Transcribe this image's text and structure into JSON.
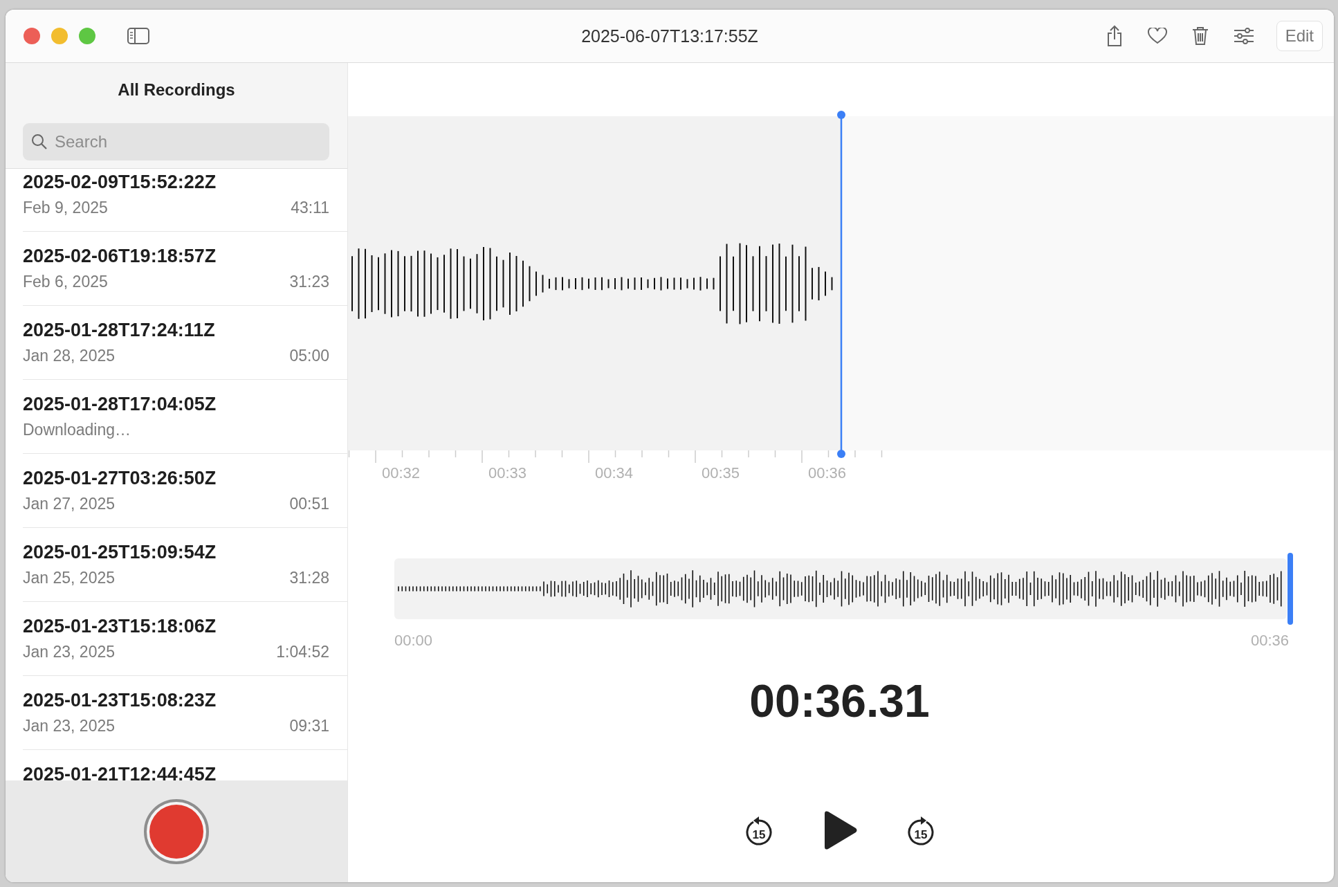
{
  "window": {
    "title": "2025-06-07T13:17:55Z"
  },
  "toolbar": {
    "edit_label": "Edit"
  },
  "sidebar": {
    "title": "All Recordings",
    "search": {
      "placeholder": "Search"
    },
    "recordings": [
      {
        "title": "2025-02-09T15:52:22Z",
        "date": "Feb 9, 2025",
        "duration": "43:11"
      },
      {
        "title": "2025-02-06T19:18:57Z",
        "date": "Feb 6, 2025",
        "duration": "31:23"
      },
      {
        "title": "2025-01-28T17:24:11Z",
        "date": "Jan 28, 2025",
        "duration": "05:00"
      },
      {
        "title": "2025-01-28T17:04:05Z",
        "status": "Downloading…"
      },
      {
        "title": "2025-01-27T03:26:50Z",
        "date": "Jan 27, 2025",
        "duration": "00:51"
      },
      {
        "title": "2025-01-25T15:09:54Z",
        "date": "Jan 25, 2025",
        "duration": "31:28"
      },
      {
        "title": "2025-01-23T15:18:06Z",
        "date": "Jan 23, 2025",
        "duration": "1:04:52"
      },
      {
        "title": "2025-01-23T15:08:23Z",
        "date": "Jan 23, 2025",
        "duration": "09:31"
      },
      {
        "title": "2025-01-21T12:44:45Z"
      }
    ]
  },
  "timeline": {
    "ticks": [
      "00:32",
      "00:33",
      "00:34",
      "00:35",
      "00:36"
    ]
  },
  "overview": {
    "start": "00:00",
    "end": "00:36",
    "level": 1
  },
  "playback": {
    "time": "00:36.31",
    "skip_back": "15",
    "skip_forward": "15"
  }
}
